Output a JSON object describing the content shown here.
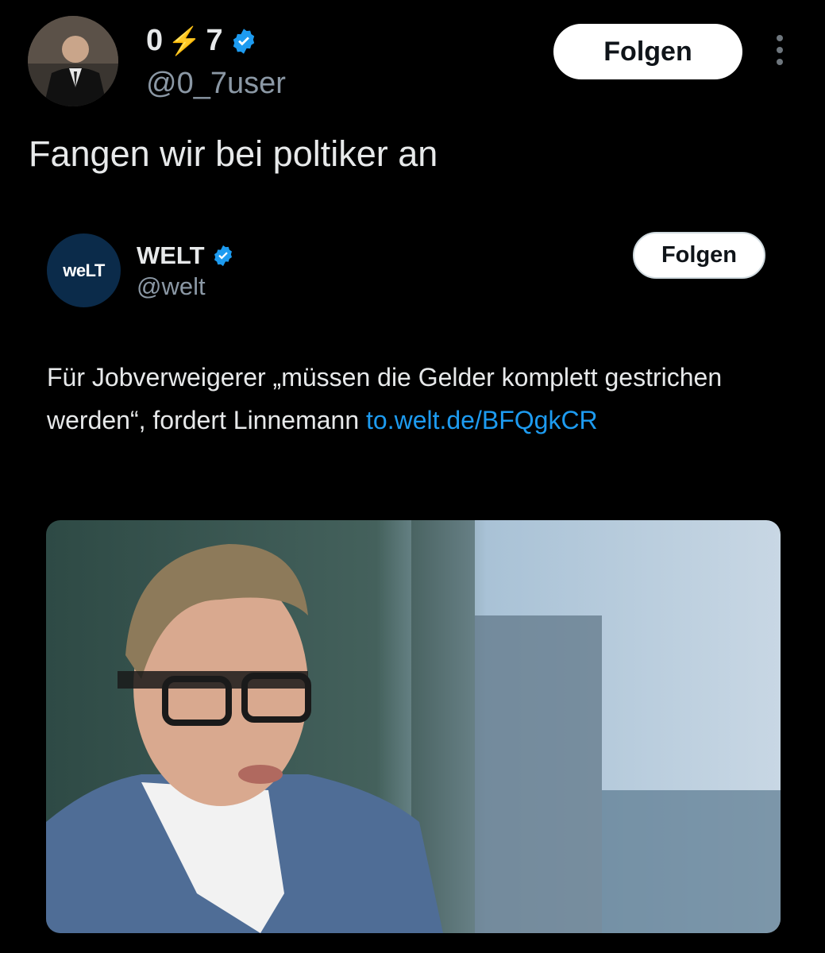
{
  "post": {
    "display_name_part1": "0",
    "display_name_bolt": "⚡",
    "display_name_part2": "7",
    "handle": "@0_7user",
    "follow_label": "Folgen",
    "text": "Fangen wir bei poltiker an"
  },
  "quoted": {
    "avatar_text": "weLT",
    "name": "WELT",
    "handle": "@welt",
    "follow_label": "Folgen",
    "text_before_link": "Für Jobverweigerer „müssen die Gelder komplett gestrichen werden“, fordert Linnemann ",
    "link_text": "to.welt.de/BFQgkCR"
  },
  "colors": {
    "background": "#000000",
    "verified_blue": "#1d9bf0",
    "link_blue": "#1d9bf0",
    "bolt": "#f5a623",
    "welt_avatar_bg": "#0b2b4a"
  },
  "icons": {
    "verified": "verified-badge-icon",
    "more": "more-vertical-icon"
  }
}
